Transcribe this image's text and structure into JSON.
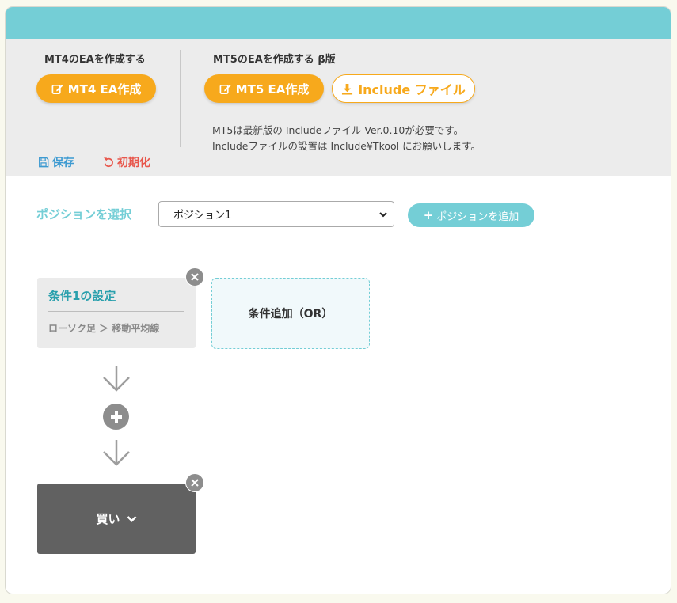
{
  "toolbar": {
    "mt4": {
      "section_title": "MT4のEAを作成する",
      "create_button": "MT4 EA作成"
    },
    "mt5": {
      "section_title": "MT5のEAを作成する β版",
      "create_button": "MT5 EA作成",
      "include_button": "Include ファイル",
      "note_line1": "MT5は最新版の Includeファイル Ver.0.10が必要です。",
      "note_line2": "Includeファイルの設置は Include¥Tkool にお願いします。"
    },
    "save_label": "保存",
    "reset_label": "初期化"
  },
  "position": {
    "label": "ポジションを選択",
    "selected": "ポジション1",
    "add_button": "ポジションを追加"
  },
  "conditions": [
    {
      "title": "条件1の設定",
      "desc": "ローソク足 ＞ 移動平均線"
    }
  ],
  "add_or_label": "条件追加（OR）",
  "action": {
    "label": "買い"
  },
  "colors": {
    "accent_teal": "#74ced6",
    "accent_orange": "#f7a91c",
    "save_blue": "#3d9ad1",
    "reset_red": "#e8574c",
    "action_dark": "#616161"
  }
}
